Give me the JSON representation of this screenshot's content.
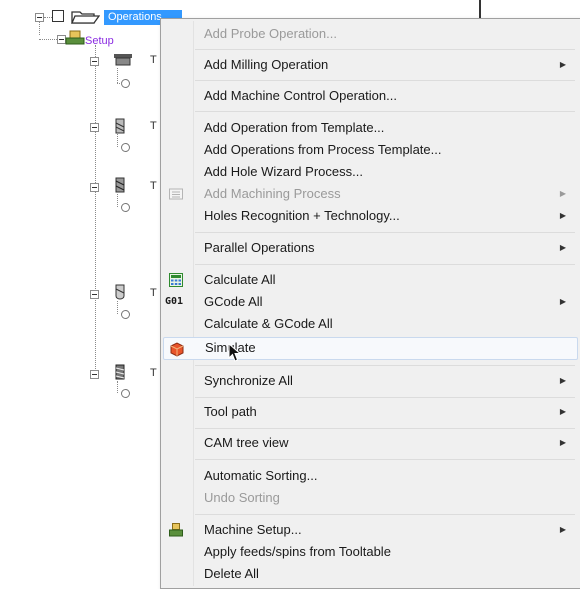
{
  "tree": {
    "root_label": "Operations",
    "setup_label": "Setup",
    "op_labels": [
      "T",
      "T",
      "T",
      "T",
      "T"
    ]
  },
  "menu": {
    "items": [
      {
        "label": "Add Probe Operation...",
        "disabled": true,
        "submenu": false
      },
      {
        "label": "Add Milling Operation",
        "disabled": false,
        "submenu": true
      },
      {
        "label": "Add Machine Control Operation...",
        "disabled": false,
        "submenu": false
      },
      {
        "label": "Add Operation from Template...",
        "disabled": false,
        "submenu": false
      },
      {
        "label": "Add Operations from Process Template...",
        "disabled": false,
        "submenu": false
      },
      {
        "label": "Add Hole Wizard Process...",
        "disabled": false,
        "submenu": false
      },
      {
        "label": "Add Machining Process",
        "disabled": true,
        "submenu": true,
        "icon": "machining-process-icon"
      },
      {
        "label": "Holes Recognition + Technology...",
        "disabled": false,
        "submenu": true
      },
      {
        "label": "Parallel Operations",
        "disabled": false,
        "submenu": true
      },
      {
        "label": "Calculate All",
        "disabled": false,
        "submenu": false,
        "icon": "calculator-icon"
      },
      {
        "label": "GCode All",
        "disabled": false,
        "submenu": true,
        "icon": "gcode-icon",
        "icon_text": "G01"
      },
      {
        "label": "Calculate & GCode All",
        "disabled": false,
        "submenu": false
      },
      {
        "label": "Simulate",
        "disabled": false,
        "submenu": false,
        "icon": "simulate-icon",
        "hover": true
      },
      {
        "label": "Synchronize All",
        "disabled": false,
        "submenu": true
      },
      {
        "label": "Tool path",
        "disabled": false,
        "submenu": true
      },
      {
        "label": "CAM tree view",
        "disabled": false,
        "submenu": true
      },
      {
        "label": "Automatic Sorting...",
        "disabled": false,
        "submenu": false
      },
      {
        "label": "Undo Sorting",
        "disabled": true,
        "submenu": false
      },
      {
        "label": "Machine Setup...",
        "disabled": false,
        "submenu": true,
        "icon": "machine-setup-icon"
      },
      {
        "label": "Apply feeds/spins from Tooltable",
        "disabled": false,
        "submenu": false
      },
      {
        "label": "Delete All",
        "disabled": false,
        "submenu": false
      }
    ],
    "submenu_arrow": "▶"
  },
  "colors": {
    "selection": "#3399ff",
    "setup_text": "#8a2be2",
    "menu_bg": "#f0f0f0",
    "disabled_text": "#9a9a9a"
  }
}
